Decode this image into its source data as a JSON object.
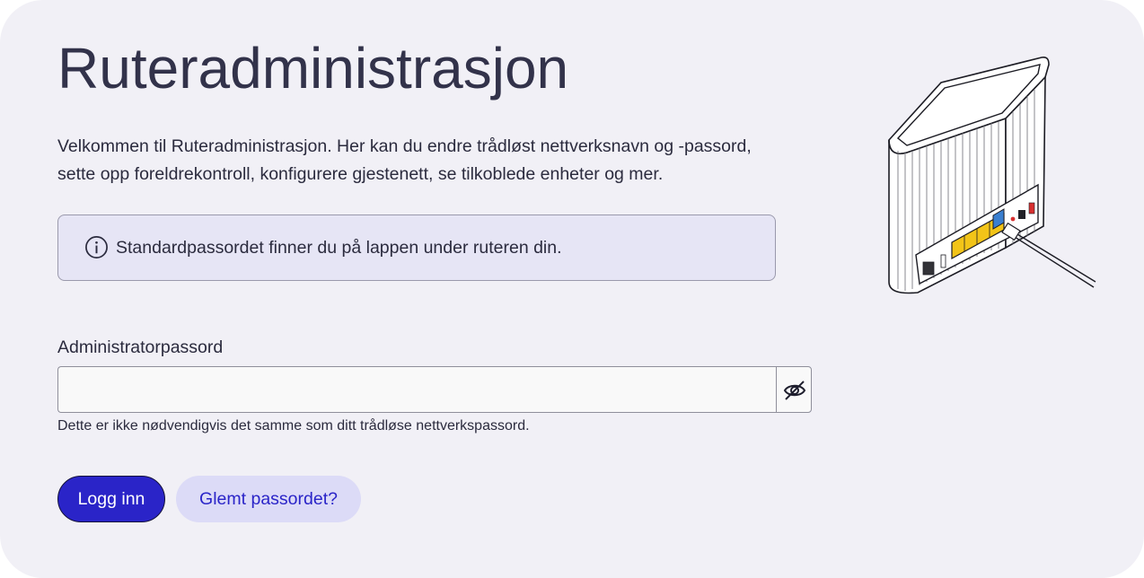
{
  "page": {
    "title": "Ruteradministrasjon",
    "intro": "Velkommen til Ruteradministrasjon. Her kan du endre trådløst nettverksnavn og -passord, sette opp foreldrekontroll, konfigurere gjestenett, se tilkoblede enheter og mer."
  },
  "info": {
    "text": "Standardpassordet finner du på lappen under ruteren din.",
    "icon": "info-icon"
  },
  "login": {
    "password_label": "Administratorpassord",
    "password_value": "",
    "password_placeholder": "",
    "toggle_icon": "eye-off-icon",
    "help_text": "Dette er ikke nødvendigvis det samme som ditt trådløse nettverkspassord.",
    "submit_label": "Logg inn",
    "forgot_label": "Glemt passordet?"
  },
  "colors": {
    "background": "#f1f0f6",
    "primary": "#2a24c8",
    "secondary_bg": "#dcdbf7",
    "info_bg": "#e6e5f5",
    "text": "#2b2b3e",
    "port_yellow": "#f2c418",
    "port_blue": "#3a7fd0",
    "port_red": "#d83030"
  }
}
